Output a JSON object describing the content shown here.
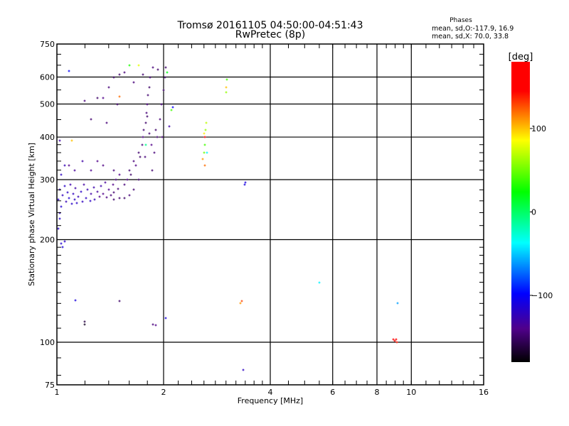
{
  "chart_data": {
    "type": "scatter",
    "title": "Tromsø 20161105 04:50:00-04:51:43",
    "subtitle": "RwPretec (8p)",
    "xlabel": "Frequency [MHz]",
    "ylabel": "Stationary phase Virtual Height [km]",
    "xscale": "log",
    "yscale": "log",
    "xlim": [
      1,
      16
    ],
    "ylim": [
      75,
      750
    ],
    "xticks": [
      1,
      2,
      4,
      6,
      8,
      10,
      16
    ],
    "yticks": [
      75,
      100,
      200,
      300,
      400,
      500,
      600,
      750
    ],
    "xgrid": [
      2,
      4,
      6,
      8,
      10
    ],
    "ygrid": [
      100,
      200,
      300,
      400,
      500,
      600
    ],
    "stats": {
      "title": "Phases",
      "line_o": "mean, sd,O:-117.9, 16.9",
      "line_x": "mean, sd,X:  70.0, 33.8"
    },
    "colorbar": {
      "label": "[deg]",
      "range": [
        -180,
        180
      ],
      "ticks": [
        100,
        0,
        -100
      ],
      "stops": [
        [
          -180,
          "#000000"
        ],
        [
          -140,
          "#50008a"
        ],
        [
          -98,
          "#0000ff"
        ],
        [
          -37,
          "#00ffff"
        ],
        [
          24,
          "#00ff00"
        ],
        [
          86,
          "#ffff00"
        ],
        [
          145,
          "#ff0000"
        ],
        [
          180,
          "#ff0000"
        ]
      ]
    },
    "points_fields": [
      "freq_MHz",
      "height_km",
      "phase_deg"
    ],
    "points": [
      [
        1.01,
        262,
        -118
      ],
      [
        1.02,
        280,
        -120
      ],
      [
        1.03,
        250,
        -115
      ],
      [
        1.04,
        270,
        -122
      ],
      [
        1.05,
        288,
        -118
      ],
      [
        1.06,
        258,
        -125
      ],
      [
        1.07,
        275,
        -120
      ],
      [
        1.08,
        265,
        -115
      ],
      [
        1.09,
        290,
        -128
      ],
      [
        1.1,
        255,
        -118
      ],
      [
        1.11,
        272,
        -122
      ],
      [
        1.12,
        262,
        -120
      ],
      [
        1.13,
        283,
        -130
      ],
      [
        1.14,
        256,
        -118
      ],
      [
        1.15,
        268,
        -125
      ],
      [
        1.17,
        276,
        -119
      ],
      [
        1.18,
        259,
        -121
      ],
      [
        1.19,
        290,
        -132
      ],
      [
        1.21,
        265,
        -120
      ],
      [
        1.22,
        280,
        -126
      ],
      [
        1.24,
        260,
        -119
      ],
      [
        1.25,
        272,
        -130
      ],
      [
        1.27,
        285,
        -128
      ],
      [
        1.28,
        262,
        -124
      ],
      [
        1.3,
        276,
        -133
      ],
      [
        1.32,
        268,
        -138
      ],
      [
        1.33,
        288,
        -128
      ],
      [
        1.35,
        272,
        -140
      ],
      [
        1.37,
        295,
        -135
      ],
      [
        1.38,
        266,
        -142
      ],
      [
        1.4,
        280,
        -138
      ],
      [
        1.42,
        270,
        -145
      ],
      [
        1.44,
        290,
        -140
      ],
      [
        1.45,
        275,
        -148
      ],
      [
        1.47,
        300,
        -142
      ],
      [
        1.49,
        282,
        -146
      ],
      [
        1.5,
        310,
        -140
      ],
      [
        1.03,
        310,
        -120
      ],
      [
        1.05,
        330,
        -125
      ],
      [
        1.02,
        390,
        -130
      ],
      [
        1.08,
        330,
        -140
      ],
      [
        1.12,
        320,
        -135
      ],
      [
        1.18,
        340,
        -130
      ],
      [
        1.25,
        320,
        -138
      ],
      [
        1.3,
        340,
        -140
      ],
      [
        1.35,
        330,
        -142
      ],
      [
        1.45,
        320,
        -145
      ],
      [
        1.02,
        230,
        -115
      ],
      [
        1.01,
        215,
        -118
      ],
      [
        1.03,
        195,
        -115
      ],
      [
        1.04,
        190,
        -112
      ],
      [
        1.05,
        198,
        -118
      ],
      [
        1.02,
        240,
        -120
      ],
      [
        1.55,
        290,
        -145
      ],
      [
        1.58,
        300,
        -140
      ],
      [
        1.6,
        320,
        -148
      ],
      [
        1.62,
        310,
        -150
      ],
      [
        1.65,
        340,
        -145
      ],
      [
        1.67,
        330,
        -142
      ],
      [
        1.7,
        360,
        -148
      ],
      [
        1.72,
        350,
        -150
      ],
      [
        1.74,
        380,
        -145
      ],
      [
        1.75,
        400,
        -140
      ],
      [
        1.76,
        420,
        -148
      ],
      [
        1.78,
        440,
        -150
      ],
      [
        1.79,
        470,
        -145
      ],
      [
        1.8,
        500,
        -142
      ],
      [
        1.81,
        530,
        -148
      ],
      [
        1.82,
        560,
        -150
      ],
      [
        1.83,
        600,
        -145
      ],
      [
        1.78,
        380,
        -10
      ],
      [
        1.8,
        460,
        -150
      ],
      [
        1.77,
        350,
        -145
      ],
      [
        1.82,
        410,
        -148
      ],
      [
        1.85,
        380,
        -140
      ],
      [
        1.88,
        360,
        -145
      ],
      [
        1.9,
        420,
        -150
      ],
      [
        1.92,
        400,
        -148
      ],
      [
        1.95,
        450,
        -145
      ],
      [
        1.97,
        500,
        -142
      ],
      [
        2.0,
        550,
        -150
      ],
      [
        2.02,
        600,
        -148
      ],
      [
        2.03,
        640,
        -150
      ],
      [
        2.05,
        620,
        20
      ],
      [
        2.08,
        430,
        -130
      ],
      [
        2.1,
        480,
        40
      ],
      [
        2.12,
        490,
        -100
      ],
      [
        1.98,
        400,
        -145
      ],
      [
        1.86,
        320,
        -148
      ],
      [
        1.7,
        300,
        -150
      ],
      [
        1.65,
        280,
        -148
      ],
      [
        1.6,
        270,
        -145
      ],
      [
        1.55,
        265,
        -150
      ],
      [
        1.5,
        265,
        -148
      ],
      [
        1.45,
        262,
        -150
      ],
      [
        1.35,
        520,
        -140
      ],
      [
        1.4,
        560,
        -145
      ],
      [
        1.45,
        600,
        -148
      ],
      [
        1.5,
        610,
        -150
      ],
      [
        1.55,
        620,
        -145
      ],
      [
        1.6,
        650,
        30
      ],
      [
        1.5,
        525,
        120
      ],
      [
        1.48,
        500,
        -148
      ],
      [
        1.38,
        440,
        -145
      ],
      [
        1.3,
        520,
        -150
      ],
      [
        1.25,
        450,
        -148
      ],
      [
        1.2,
        510,
        -145
      ],
      [
        1.08,
        625,
        -100
      ],
      [
        1.1,
        390,
        100
      ],
      [
        1.7,
        650,
        80
      ],
      [
        1.65,
        580,
        -145
      ],
      [
        1.75,
        610,
        -148
      ],
      [
        1.87,
        640,
        -145
      ],
      [
        1.93,
        630,
        -150
      ],
      [
        2.58,
        345,
        110
      ],
      [
        2.6,
        360,
        50
      ],
      [
        2.61,
        380,
        40
      ],
      [
        2.62,
        400,
        150
      ],
      [
        2.63,
        420,
        60
      ],
      [
        2.64,
        440,
        70
      ],
      [
        2.65,
        360,
        -40
      ],
      [
        2.6,
        410,
        90
      ],
      [
        2.62,
        330,
        120
      ],
      [
        3.0,
        560,
        100
      ],
      [
        3.01,
        540,
        60
      ],
      [
        3.02,
        590,
        40
      ],
      [
        9.0,
        101,
        170
      ],
      [
        9.05,
        102,
        160
      ],
      [
        9.1,
        100,
        140
      ],
      [
        8.9,
        102,
        175
      ],
      [
        9.15,
        130,
        -60
      ],
      [
        3.3,
        130,
        110
      ],
      [
        3.32,
        132,
        130
      ],
      [
        3.4,
        295,
        -110
      ],
      [
        3.38,
        290,
        -110
      ],
      [
        3.35,
        83,
        -120
      ],
      [
        5.5,
        150,
        -40
      ],
      [
        1.9,
        112,
        -140
      ],
      [
        1.87,
        113,
        -145
      ],
      [
        1.2,
        115,
        -160
      ],
      [
        1.2,
        113,
        -170
      ],
      [
        1.5,
        132,
        -150
      ],
      [
        1.13,
        133,
        -110
      ],
      [
        2.03,
        118,
        -110
      ]
    ]
  }
}
